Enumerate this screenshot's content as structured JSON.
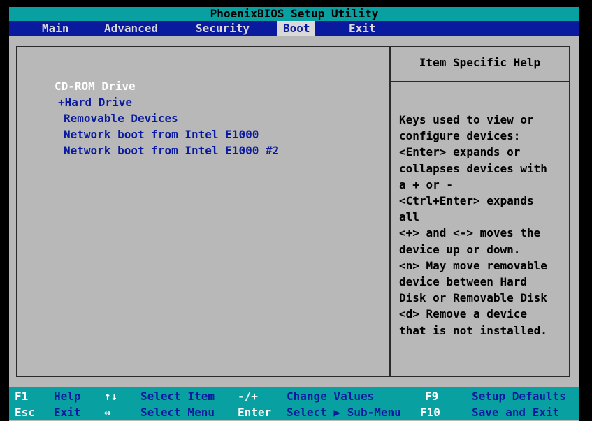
{
  "title": "PhoenixBIOS Setup Utility",
  "menu": {
    "items": [
      {
        "label": "Main"
      },
      {
        "label": "Advanced"
      },
      {
        "label": "Security"
      },
      {
        "label": "Boot"
      },
      {
        "label": "Exit"
      }
    ],
    "active": "Boot"
  },
  "boot_order": {
    "items": [
      {
        "label": "CD-ROM Drive",
        "selected": true
      },
      {
        "label": "+Hard Drive",
        "selected": false
      },
      {
        "label": "Removable Devices",
        "selected": false
      },
      {
        "label": "Network boot from Intel E1000",
        "selected": false
      },
      {
        "label": "Network boot from Intel E1000 #2",
        "selected": false
      }
    ]
  },
  "help": {
    "title": "Item Specific Help",
    "lines": [
      "Keys used to view or",
      "configure devices:",
      "<Enter> expands or",
      "collapses devices with",
      "a + or -",
      "<Ctrl+Enter> expands",
      "all",
      "<+> and <-> moves the",
      "device up or down.",
      "<n> May move removable",
      "device between Hard",
      "Disk or Removable Disk",
      "<d> Remove a device",
      "that is not installed."
    ]
  },
  "footer": {
    "row1": [
      {
        "key": "F1",
        "label": "Help"
      },
      {
        "key": "↑↓",
        "label": "Select Item"
      },
      {
        "key": "-/+",
        "label": "Change Values"
      },
      {
        "key": "F9",
        "label": "Setup Defaults"
      }
    ],
    "row2": [
      {
        "key": "Esc",
        "label": "Exit"
      },
      {
        "key": "↔",
        "label": "Select Menu"
      },
      {
        "key": "Enter",
        "label": "Select ▶ Sub-Menu"
      },
      {
        "key": "F10",
        "label": "Save and Exit"
      }
    ]
  },
  "colors": {
    "title_bar": "#08a0a0",
    "menu_bar": "#0a1a9f",
    "panel_bg": "#b8b8b8",
    "selected_item": "#ffffff",
    "item_text": "#0a1a9f"
  }
}
